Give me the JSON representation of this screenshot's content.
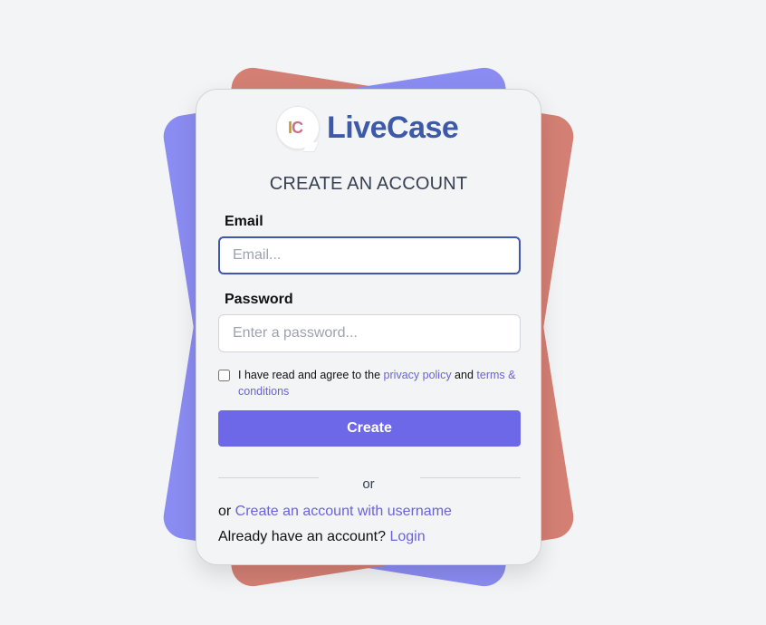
{
  "brand": {
    "logo_initial_1": "I",
    "logo_initial_2": "C",
    "name": "LiveCase"
  },
  "form": {
    "title": "CREATE AN ACCOUNT",
    "email_label": "Email",
    "email_placeholder": "Email...",
    "password_label": "Password",
    "password_placeholder": "Enter a password...",
    "terms_prefix": "I have read and agree to the ",
    "privacy_link": "privacy policy",
    "terms_and": " and ",
    "terms_link": "terms & conditions",
    "submit_label": "Create",
    "divider_text": "or",
    "username_prefix": "or ",
    "username_link": "Create an account with username",
    "login_prefix": "Already have an account? ",
    "login_link": "Login"
  },
  "colors": {
    "accent": "#6d68e8",
    "link": "#6a63d9",
    "brand": "#3d5aa8",
    "bg_card_red": "#d47f74",
    "bg_card_blue": "#8b8cf2"
  }
}
